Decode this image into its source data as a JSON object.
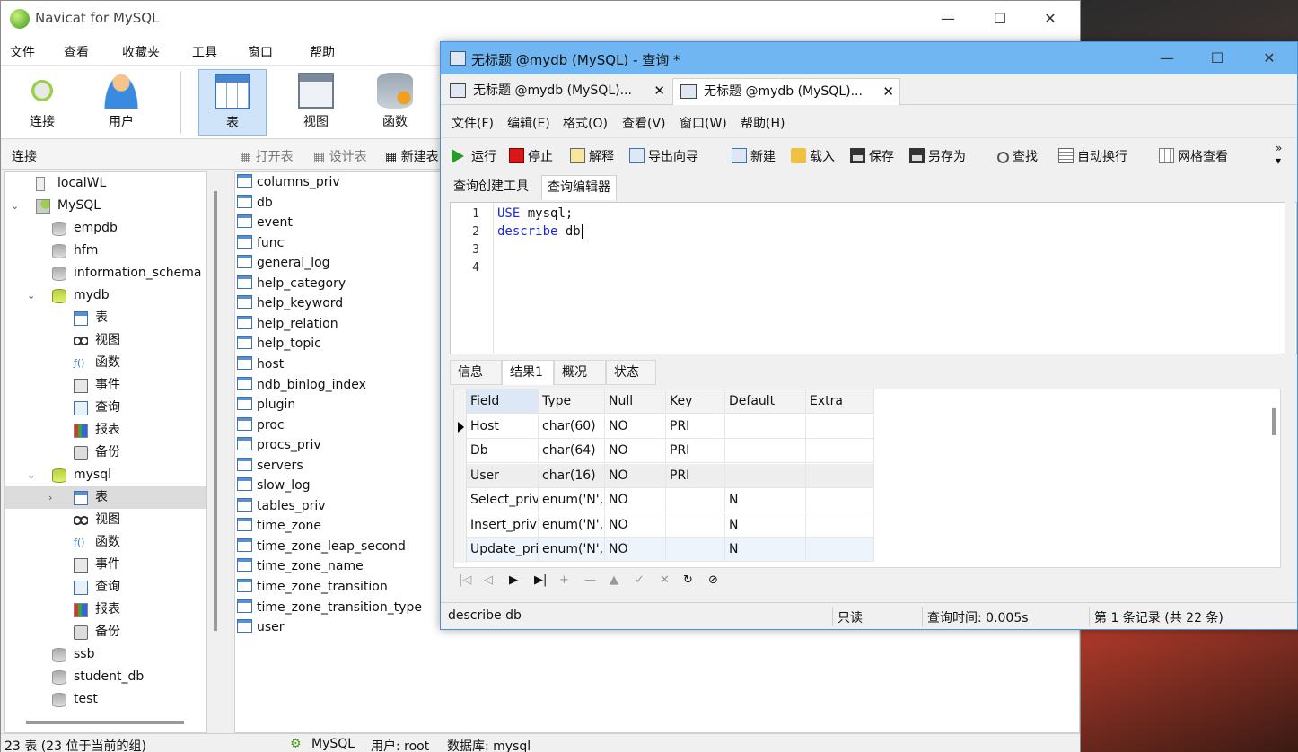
{
  "main": {
    "title": "Navicat for MySQL",
    "menu": [
      "文件",
      "查看",
      "收藏夹",
      "工具",
      "窗口",
      "帮助"
    ],
    "toolbar": [
      "连接",
      "用户",
      "表",
      "视图",
      "函数"
    ],
    "conn_label": "连接",
    "obj_buttons": [
      "打开表",
      "设计表",
      "新建表"
    ],
    "tree": [
      {
        "label": "localWL",
        "level": 0,
        "icon": "server-icon"
      },
      {
        "label": "MySQL",
        "level": 0,
        "icon": "mysql-connection-icon",
        "expanded": true
      },
      {
        "label": "empdb",
        "level": 1,
        "icon": "database-icon"
      },
      {
        "label": "hfm",
        "level": 1,
        "icon": "database-icon"
      },
      {
        "label": "information_schema",
        "level": 1,
        "icon": "database-icon"
      },
      {
        "label": "mydb",
        "level": 1,
        "icon": "database-icon",
        "expanded": true
      },
      {
        "label": "表",
        "level": 2,
        "icon": "table-icon"
      },
      {
        "label": "视图",
        "level": 2,
        "icon": "view-icon"
      },
      {
        "label": "函数",
        "level": 2,
        "icon": "function-icon"
      },
      {
        "label": "事件",
        "level": 2,
        "icon": "event-icon"
      },
      {
        "label": "查询",
        "level": 2,
        "icon": "query-icon"
      },
      {
        "label": "报表",
        "level": 2,
        "icon": "report-icon"
      },
      {
        "label": "备份",
        "level": 2,
        "icon": "backup-icon"
      },
      {
        "label": "mysql",
        "level": 1,
        "icon": "database-icon",
        "expanded": true
      },
      {
        "label": "表",
        "level": 2,
        "icon": "table-icon",
        "selected": true,
        "collapsed": true
      },
      {
        "label": "视图",
        "level": 2,
        "icon": "view-icon"
      },
      {
        "label": "函数",
        "level": 2,
        "icon": "function-icon"
      },
      {
        "label": "事件",
        "level": 2,
        "icon": "event-icon"
      },
      {
        "label": "查询",
        "level": 2,
        "icon": "query-icon"
      },
      {
        "label": "报表",
        "level": 2,
        "icon": "report-icon"
      },
      {
        "label": "备份",
        "level": 2,
        "icon": "backup-icon"
      },
      {
        "label": "ssb",
        "level": 1,
        "icon": "database-icon"
      },
      {
        "label": "student_db",
        "level": 1,
        "icon": "database-icon"
      },
      {
        "label": "test",
        "level": 1,
        "icon": "database-icon"
      }
    ],
    "tables": [
      "columns_priv",
      "db",
      "event",
      "func",
      "general_log",
      "help_category",
      "help_keyword",
      "help_relation",
      "help_topic",
      "host",
      "ndb_binlog_index",
      "plugin",
      "proc",
      "procs_priv",
      "servers",
      "slow_log",
      "tables_priv",
      "time_zone",
      "time_zone_leap_second",
      "time_zone_name",
      "time_zone_transition",
      "time_zone_transition_type",
      "user"
    ],
    "status": {
      "count": "23 表 (23 位于当前的组)",
      "conn": "MySQL",
      "user": "用户: root",
      "db": "数据库: mysql"
    }
  },
  "query": {
    "title": "无标题 @mydb (MySQL) - 查询 *",
    "tabs": [
      "无标题 @mydb (MySQL)...",
      "无标题 @mydb (MySQL)..."
    ],
    "menu": [
      "文件(F)",
      "编辑(E)",
      "格式(O)",
      "查看(V)",
      "窗口(W)",
      "帮助(H)"
    ],
    "toolbar": [
      "运行",
      "停止",
      "解释",
      "导出向导",
      "新建",
      "载入",
      "保存",
      "另存为",
      "查找",
      "自动换行",
      "网格查看"
    ],
    "subtabs": [
      "查询创建工具",
      "查询编辑器"
    ],
    "line_numbers": [
      "1",
      "2",
      "3",
      "4"
    ],
    "code": [
      {
        "kw": "USE",
        "rest": " mysql;"
      },
      {
        "kw": "describe",
        "rest": " db"
      }
    ],
    "result_tabs": [
      "信息",
      "结果1",
      "概况",
      "状态"
    ],
    "grid": {
      "columns": [
        "Field",
        "Type",
        "Null",
        "Key",
        "Default",
        "Extra"
      ],
      "rows": [
        [
          "Host",
          "char(60)",
          "NO",
          "PRI",
          "",
          ""
        ],
        [
          "Db",
          "char(64)",
          "NO",
          "PRI",
          "",
          ""
        ],
        [
          "User",
          "char(16)",
          "NO",
          "PRI",
          "",
          ""
        ],
        [
          "Select_priv",
          "enum('N',",
          "NO",
          "",
          "N",
          ""
        ],
        [
          "Insert_priv",
          "enum('N',",
          "NO",
          "",
          "N",
          ""
        ],
        [
          "Update_priv",
          "enum('N',",
          "NO",
          "",
          "N",
          ""
        ]
      ]
    },
    "nav": [
      "|◁",
      "◁",
      "▶",
      "▶|",
      "+",
      "—",
      "▲",
      "✓",
      "✕",
      "↻",
      "⊘"
    ],
    "status": {
      "sql": "describe db",
      "mode": "只读",
      "time": "查询时间: 0.005s",
      "records": "第 1 条记录 (共 22 条)"
    }
  },
  "colors": {
    "accent": "#6fb6f2",
    "selection": "#cfe4f8",
    "keyword": "#1a2ad8"
  }
}
